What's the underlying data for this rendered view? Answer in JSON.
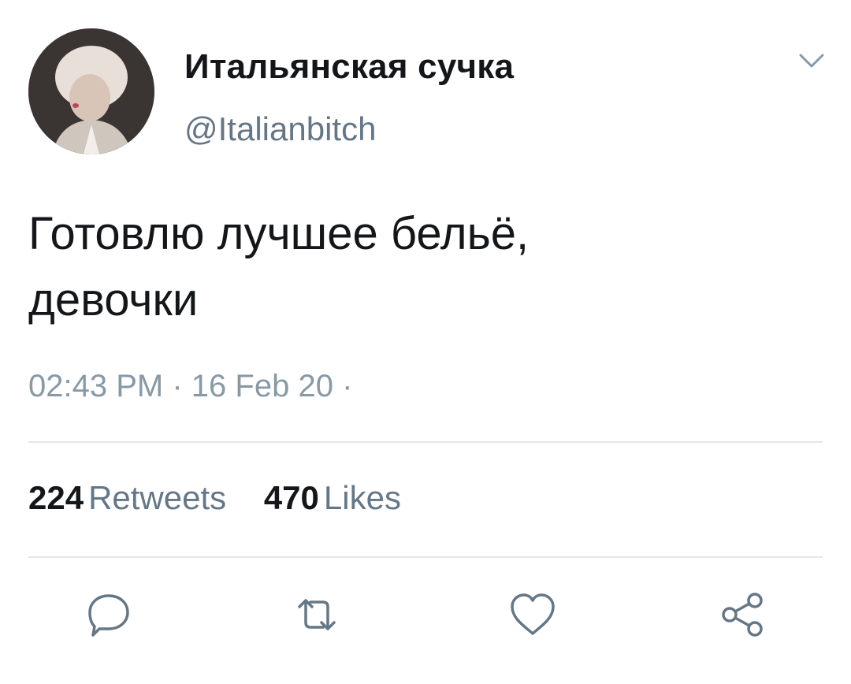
{
  "tweet": {
    "author": {
      "display_name": "Итальянская сучка",
      "handle": "@Italianbitch"
    },
    "text_lines": [
      "Готовлю лучшее бельё,",
      "девочки"
    ],
    "time": "02:43 PM",
    "separator": "·",
    "date": "16 Feb 20",
    "stats": {
      "retweets_count": "224",
      "retweets_label": "Retweets",
      "likes_count": "470",
      "likes_label": "Likes"
    },
    "actions": {
      "reply_icon": "reply-icon",
      "retweet_icon": "retweet-icon",
      "like_icon": "heart-icon",
      "share_icon": "share-icon"
    }
  },
  "colors": {
    "text_primary": "#14171a",
    "text_secondary": "#657786",
    "meta_gray": "#8899a6",
    "divider": "#e1e8ed",
    "icon_gray": "#657786"
  }
}
